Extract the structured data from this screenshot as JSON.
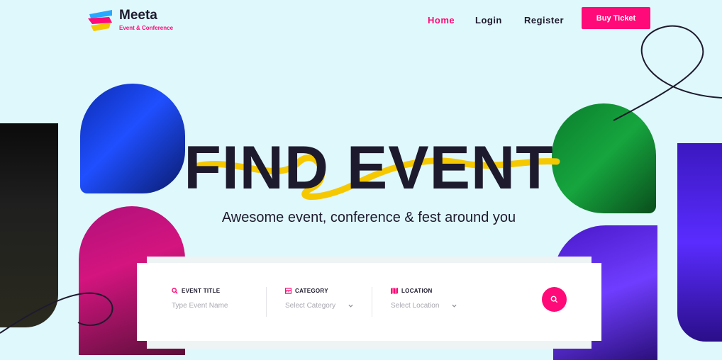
{
  "brand": {
    "name": "Meeta",
    "tagline": "Event & Conference",
    "colors": {
      "accent": "#ff0a78",
      "dark": "#1e1a2e",
      "background": "#dff8fb",
      "scribble": "#f5c800"
    }
  },
  "nav": {
    "items": [
      {
        "label": "Home",
        "active": true
      },
      {
        "label": "Login",
        "active": false
      },
      {
        "label": "Register",
        "active": false
      }
    ],
    "cta_label": "Buy Ticket"
  },
  "hero": {
    "title": "FIND EVENT",
    "subtitle": "Awesome event, conference & fest around you"
  },
  "search": {
    "fields": [
      {
        "label": "EVENT TITLE",
        "icon": "search-icon",
        "placeholder": "Type Event Name"
      },
      {
        "label": "CATEGORY",
        "icon": "calendar-icon",
        "selected": "Select Category"
      },
      {
        "label": "LOCATION",
        "icon": "map-icon",
        "selected": "Select Location"
      }
    ],
    "submit_icon": "search-icon"
  }
}
